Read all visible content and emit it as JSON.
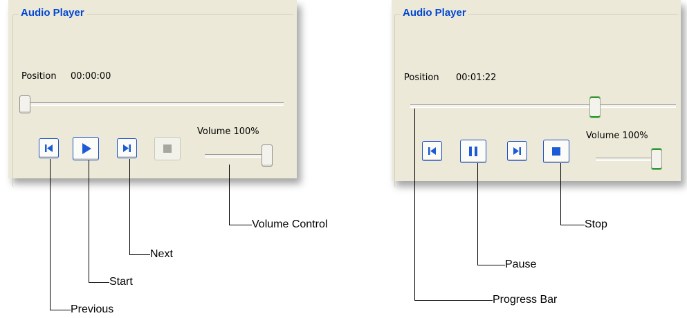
{
  "left_player": {
    "title": "Audio Player",
    "position_label": "Position",
    "position_time": "00:00:00",
    "progress_fraction": 0.0,
    "volume_label": "Volume 100%",
    "volume_fraction": 1.0,
    "state": "stopped",
    "buttons": [
      {
        "name": "previous",
        "icon": "skip-previous-icon",
        "enabled": true
      },
      {
        "name": "start",
        "icon": "play-icon",
        "enabled": true
      },
      {
        "name": "next",
        "icon": "skip-next-icon",
        "enabled": true
      },
      {
        "name": "stop",
        "icon": "stop-icon",
        "enabled": false
      }
    ]
  },
  "right_player": {
    "title": "Audio Player",
    "position_label": "Position",
    "position_time": "00:01:22",
    "progress_fraction": 0.7,
    "volume_label": "Volume 100%",
    "volume_fraction": 1.0,
    "state": "playing",
    "buttons": [
      {
        "name": "previous",
        "icon": "skip-previous-icon",
        "enabled": true
      },
      {
        "name": "pause",
        "icon": "pause-icon",
        "enabled": true
      },
      {
        "name": "next",
        "icon": "skip-next-icon",
        "enabled": true
      },
      {
        "name": "stop",
        "icon": "stop-icon",
        "enabled": true
      }
    ]
  },
  "callouts": {
    "volume_control": "Volume Control",
    "next": "Next",
    "start": "Start",
    "previous": "Previous",
    "stop": "Stop",
    "pause": "Pause",
    "progress_bar": "Progress Bar"
  },
  "colors": {
    "accent": "#0046d5",
    "button_border": "#1b4fc4",
    "icon_blue": "#1d5bd6",
    "active_thumb": "#21a121",
    "panel_bg": "#ece9d8"
  }
}
